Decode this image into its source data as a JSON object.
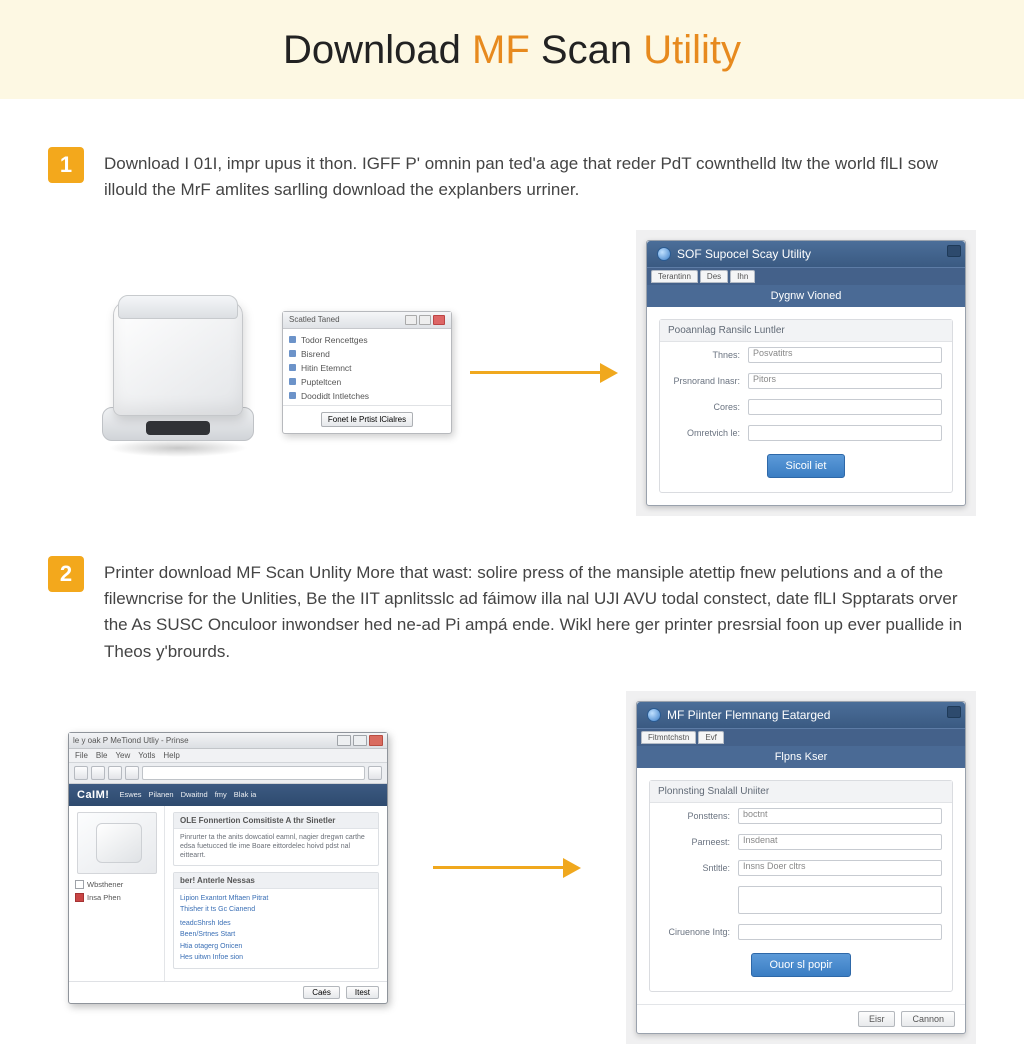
{
  "title": {
    "pre": "Download ",
    "mf": "MF",
    "mid": " Scan ",
    "util": "Utility"
  },
  "steps": {
    "1": "1",
    "2": "2"
  },
  "step1_text": "Download I 01I, impr upus it thon. IGFF P' omnin pan ted'a age that reder PdT cownthelld ltw the world flLI sow illould the MrF amlites sarlling download the explanbers urriner.",
  "step2_text": "Printer download MF Scan Unlity More that wast: solire press of the mansiple atettip fnew pelutions and a of the filewncrise for the Unlities, Be the IIT apnlitsslc ad fáimow illa nal UJI AVU todal constect, date flLI Spptarats orver the As SUSC Onculoor inwondser hed ne-ad Pi ampá ende. Wikl here ger printer presrsial foon up ever puallide in Theos y'brourds.",
  "mini_dialog": {
    "title": "Scatled Taned",
    "items": [
      "Todor Rencettges",
      "Bisrend",
      "Hitin Etemnct",
      "Pupteltcen",
      "Doodidt Intletches"
    ],
    "button": "Fonet le Prtist lCialres"
  },
  "panel1": {
    "header": "SOF Supocel Scay Utility",
    "tab1": "Terantinn",
    "tab2": "Des",
    "tab3": "Ihn",
    "banner": "Dygnw Vioned",
    "fh": "Pooannlag Ransilc Luntler",
    "row1_label": "Thnes:",
    "row1_value": "Posvatitrs",
    "row2_label": "Prsnorand Inasr:",
    "row2_value": "Pitors",
    "row3_label": "Cores:",
    "row4_label": "Omretvich le:",
    "button": "Sicoil iet"
  },
  "browser": {
    "title": "le y oak P MeTiond Utliy - Prinse",
    "menu": [
      "File",
      "Ble",
      "Yew",
      "Yotls",
      "Help"
    ],
    "logo": "CaIM!",
    "nav": [
      "Eswes",
      "Pilanen",
      "Dwaitnd",
      "fmy",
      "Blak ia"
    ],
    "panel1_title": "OLE Fonnertion Comsitiste A thr Sinetler",
    "panel1_body": "Pinrurter ta the anits dowcatiol eamnl, nagier dregwn carthe edsa fuetucced tle ime Boare eittordelec hoivd pdst nal eittearrt.",
    "panel2_title": "ber! Anterle Nessas",
    "panel2_items": [
      "Lipion Exantort Mftaen Pitrat",
      "Thisher it ts Gc Cianend",
      "",
      "teadcShrsh Ides",
      "Been/Srtnes Start",
      "Htia otagerg Onicen",
      "Hes uitwn Infoe sion"
    ],
    "chk1": "Wbsthener",
    "chk2": "Insa Phen",
    "foot1": "Caés",
    "foot2": "Itest"
  },
  "panel2": {
    "header": "MF Piinter Flemnang Eatarged",
    "tab1": "Fitmntchstn",
    "tab2": "Evf",
    "banner": "Flpns Kser",
    "fh": "Plonnsting Snalall Uniiter",
    "row1_label": "Ponsttens:",
    "row1_value": "boctnt",
    "row2_label": "Parneest:",
    "row2_value": "Insdenat",
    "row3_label": "Sntltle:",
    "row3_value": "Insns Doer cltrs",
    "row4_label": "Ciruenone Intg:",
    "button": "Ouor sl popir",
    "foot1": "Eisr",
    "foot2": "Cannon"
  }
}
